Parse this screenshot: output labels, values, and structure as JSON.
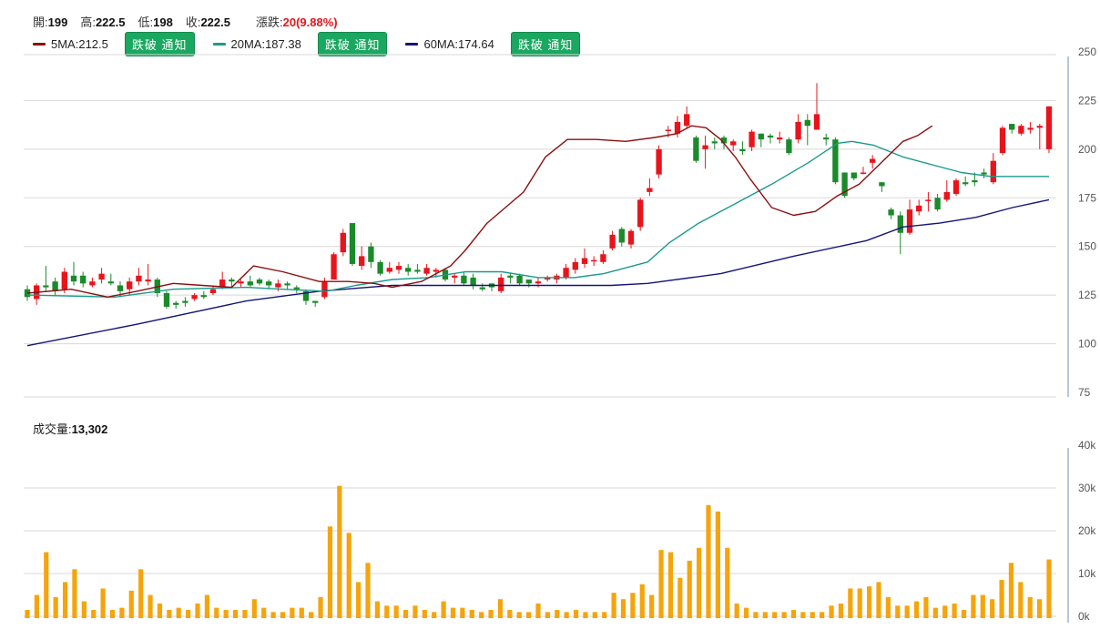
{
  "header": {
    "open_label": "開:",
    "open": "199",
    "high_label": "高:",
    "high": "222.5",
    "low_label": "低:",
    "low": "198",
    "close_label": "收:",
    "close": "222.5",
    "change_label": "漲跌:",
    "change": "20(9.88%)"
  },
  "ma_legend": [
    {
      "label": "5MA:212.5",
      "color": "#8b0e0e",
      "button": "跌破 通知"
    },
    {
      "label": "20MA:187.38",
      "color": "#1a9a8c",
      "button": "跌破 通知"
    },
    {
      "label": "60MA:174.64",
      "color": "#14147a",
      "button": "跌破 通知"
    }
  ],
  "volume_header": {
    "label": "成交量:",
    "value": "13,302"
  },
  "colors": {
    "up": "#e8141c",
    "down": "#1a8a2a",
    "volume": "#f5a40c",
    "ma5": "#8b0e0e",
    "ma20": "#1a9a8c",
    "ma60": "#14147a",
    "grid": "#d8d8d8"
  },
  "chart_data": [
    {
      "type": "candlestick",
      "ylim": [
        75,
        250
      ],
      "yticks": [
        250,
        225,
        200,
        175,
        150,
        125,
        100,
        75
      ],
      "candles": [
        [
          128,
          124,
          130,
          122
        ],
        [
          123,
          130,
          131,
          120
        ],
        [
          130,
          129,
          140,
          127
        ],
        [
          132,
          127,
          134,
          125
        ],
        [
          128,
          137,
          139,
          126
        ],
        [
          135,
          132,
          142,
          130
        ],
        [
          135,
          131,
          137,
          129
        ],
        [
          130,
          132,
          134,
          129
        ],
        [
          133,
          136,
          139,
          131
        ],
        [
          132,
          131,
          136,
          130
        ],
        [
          130,
          127,
          132,
          124
        ],
        [
          128,
          132,
          134,
          125
        ],
        [
          132,
          135,
          139,
          130
        ],
        [
          132,
          133,
          141,
          130
        ],
        [
          133,
          126,
          134,
          124
        ],
        [
          126,
          119,
          127,
          118
        ],
        [
          121,
          120,
          122,
          118
        ],
        [
          122,
          121,
          124,
          119
        ],
        [
          123,
          125,
          126,
          122
        ],
        [
          125,
          124,
          127,
          123
        ],
        [
          126,
          128,
          130,
          125
        ],
        [
          129,
          133,
          137,
          128
        ],
        [
          133,
          132,
          134,
          129
        ],
        [
          131,
          132,
          133,
          129
        ],
        [
          132,
          130,
          135,
          129
        ],
        [
          133,
          131,
          134,
          130
        ],
        [
          132,
          130,
          133,
          128
        ],
        [
          129,
          131,
          133,
          127
        ],
        [
          131,
          130,
          132,
          128
        ],
        [
          129,
          128,
          130,
          126
        ],
        [
          127,
          122,
          128,
          120
        ],
        [
          122,
          121,
          122,
          119
        ],
        [
          124,
          132,
          134,
          123
        ],
        [
          133,
          146,
          147,
          133
        ],
        [
          147,
          157,
          159,
          145
        ],
        [
          162,
          141,
          162,
          140
        ],
        [
          140,
          145,
          150,
          138
        ],
        [
          150,
          142,
          152,
          139
        ],
        [
          142,
          136,
          143,
          135
        ],
        [
          137,
          139,
          142,
          136
        ],
        [
          138,
          140,
          142,
          136
        ],
        [
          139,
          137,
          141,
          135
        ],
        [
          138,
          137,
          141,
          136
        ],
        [
          136,
          139,
          141,
          135
        ],
        [
          137,
          138,
          139,
          134
        ],
        [
          138,
          133,
          139,
          132
        ],
        [
          134,
          135,
          136,
          131
        ],
        [
          135,
          131,
          137,
          130
        ],
        [
          134,
          130,
          136,
          128
        ],
        [
          129,
          128,
          131,
          127
        ],
        [
          131,
          129,
          131,
          127
        ],
        [
          127,
          134,
          136,
          126
        ],
        [
          135,
          134,
          136,
          131
        ],
        [
          135,
          131,
          136,
          130
        ],
        [
          133,
          131,
          133,
          129
        ],
        [
          131,
          132,
          134,
          129
        ],
        [
          133,
          134,
          135,
          132
        ],
        [
          133,
          135,
          136,
          131
        ],
        [
          134,
          139,
          141,
          133
        ],
        [
          138,
          142,
          144,
          136
        ],
        [
          141,
          144,
          149,
          139
        ],
        [
          143,
          143,
          145,
          140
        ],
        [
          142,
          146,
          148,
          141
        ],
        [
          149,
          156,
          158,
          148
        ],
        [
          159,
          152,
          160,
          150
        ],
        [
          151,
          158,
          159,
          149
        ],
        [
          160,
          174,
          175,
          158
        ],
        [
          178,
          180,
          185,
          176
        ],
        [
          187,
          200,
          202,
          185
        ],
        [
          210,
          210,
          212,
          206
        ],
        [
          208,
          214,
          217,
          206
        ],
        [
          212,
          218,
          222,
          211
        ],
        [
          206,
          194,
          207,
          193
        ],
        [
          200,
          202,
          207,
          190
        ],
        [
          204,
          203,
          206,
          200
        ],
        [
          206,
          203,
          207,
          200
        ],
        [
          202,
          204,
          205,
          199
        ],
        [
          200,
          199,
          204,
          197
        ],
        [
          201,
          209,
          210,
          199
        ],
        [
          208,
          205,
          208,
          201
        ],
        [
          207,
          206,
          208,
          203
        ],
        [
          205,
          206,
          209,
          203
        ],
        [
          205,
          198,
          206,
          197
        ],
        [
          205,
          214,
          218,
          203
        ],
        [
          215,
          212,
          218,
          202
        ],
        [
          210,
          218,
          234,
          210
        ],
        [
          206,
          205,
          208,
          202
        ],
        [
          205,
          183,
          206,
          182
        ],
        [
          188,
          176,
          188,
          175
        ],
        [
          188,
          185,
          187,
          184
        ],
        [
          188,
          188,
          191,
          187
        ],
        [
          193,
          195,
          197,
          190
        ],
        [
          183,
          181,
          183,
          178
        ],
        [
          169,
          166,
          170,
          164
        ],
        [
          166,
          157,
          168,
          146
        ],
        [
          157,
          169,
          174,
          156
        ],
        [
          168,
          171,
          174,
          166
        ],
        [
          174,
          174,
          178,
          168
        ],
        [
          175,
          169,
          177,
          168
        ],
        [
          174,
          178,
          184,
          173
        ],
        [
          177,
          184,
          185,
          176
        ],
        [
          183,
          182,
          186,
          181
        ],
        [
          184,
          183,
          188,
          181
        ],
        [
          188,
          187,
          190,
          185
        ],
        [
          183,
          194,
          198,
          182
        ],
        [
          198,
          211,
          212,
          197
        ],
        [
          213,
          210,
          213,
          208
        ],
        [
          208,
          212,
          213,
          207
        ],
        [
          210,
          211,
          214,
          208
        ],
        [
          211,
          212,
          213,
          200
        ],
        [
          200,
          222,
          222,
          198
        ]
      ],
      "ma5": [
        [
          0,
          126
        ],
        [
          12,
          128
        ],
        [
          22,
          124
        ],
        [
          30,
          127
        ],
        [
          40,
          131
        ],
        [
          48,
          130
        ],
        [
          56,
          129
        ],
        [
          62,
          140
        ],
        [
          70,
          137
        ],
        [
          80,
          132
        ],
        [
          88,
          132
        ],
        [
          95,
          131
        ],
        [
          100,
          129
        ],
        [
          108,
          132
        ],
        [
          116,
          140
        ],
        [
          120,
          148
        ],
        [
          126,
          162
        ],
        [
          136,
          178
        ],
        [
          142,
          196
        ],
        [
          148,
          205
        ],
        [
          156,
          205
        ],
        [
          164,
          204
        ],
        [
          172,
          206
        ],
        [
          178,
          208
        ],
        [
          182,
          212
        ],
        [
          186,
          211
        ],
        [
          190,
          205
        ],
        [
          194,
          196
        ],
        [
          198,
          185
        ],
        [
          204,
          170
        ],
        [
          210,
          166
        ],
        [
          216,
          168
        ],
        [
          222,
          176
        ],
        [
          228,
          182
        ],
        [
          234,
          193
        ],
        [
          240,
          204
        ],
        [
          244,
          207
        ],
        [
          248,
          212
        ]
      ],
      "ma20": [
        [
          0,
          125
        ],
        [
          24,
          124
        ],
        [
          40,
          128
        ],
        [
          60,
          129
        ],
        [
          70,
          128
        ],
        [
          82,
          127
        ],
        [
          90,
          130
        ],
        [
          100,
          133
        ],
        [
          110,
          134
        ],
        [
          120,
          137
        ],
        [
          130,
          137
        ],
        [
          140,
          134
        ],
        [
          150,
          134
        ],
        [
          158,
          136
        ],
        [
          164,
          139
        ],
        [
          170,
          142
        ],
        [
          176,
          152
        ],
        [
          184,
          162
        ],
        [
          194,
          172
        ],
        [
          204,
          182
        ],
        [
          214,
          193
        ],
        [
          222,
          203
        ],
        [
          226,
          204
        ],
        [
          232,
          202
        ],
        [
          240,
          196
        ],
        [
          248,
          192
        ],
        [
          256,
          188
        ],
        [
          264,
          186
        ],
        [
          272,
          186
        ],
        [
          280,
          186
        ]
      ],
      "ma60": [
        [
          0,
          99
        ],
        [
          30,
          110
        ],
        [
          60,
          122
        ],
        [
          80,
          127
        ],
        [
          100,
          130
        ],
        [
          120,
          130
        ],
        [
          140,
          130
        ],
        [
          160,
          130
        ],
        [
          170,
          131
        ],
        [
          190,
          136
        ],
        [
          210,
          145
        ],
        [
          230,
          153
        ],
        [
          240,
          160
        ],
        [
          250,
          162
        ],
        [
          260,
          165
        ],
        [
          270,
          170
        ],
        [
          280,
          174
        ]
      ],
      "x_first": 30,
      "x_last": 1152,
      "ma_x_units": 280
    },
    {
      "type": "bar",
      "ylim": [
        0,
        40000
      ],
      "yticks": [
        "40k",
        "30k",
        "20k",
        "10k",
        "0k"
      ],
      "values": [
        1500,
        5000,
        15000,
        4500,
        8000,
        11000,
        3500,
        1500,
        6500,
        1500,
        2000,
        6000,
        11000,
        5000,
        3000,
        1500,
        2000,
        1500,
        3000,
        5000,
        2000,
        1500,
        1500,
        1500,
        4000,
        2000,
        1000,
        1000,
        2000,
        2000,
        1000,
        4500,
        21000,
        30500,
        19500,
        8000,
        12500,
        3500,
        2500,
        2500,
        1500,
        2500,
        1500,
        1000,
        3500,
        2000,
        2000,
        1500,
        1000,
        1500,
        4000,
        1500,
        1000,
        1000,
        3000,
        1000,
        1500,
        1000,
        1500,
        1000,
        1000,
        1000,
        5500,
        4000,
        5500,
        7500,
        5000,
        15500,
        15000,
        9000,
        13000,
        16000,
        26000,
        24500,
        16000,
        3000,
        2000,
        1000,
        1000,
        1000,
        1000,
        1500,
        1000,
        1000,
        1000,
        2500,
        3000,
        6500,
        6500,
        7000,
        8000,
        4500,
        2500,
        2500,
        3500,
        4500,
        2000,
        2500,
        3000,
        1500,
        5000,
        5000,
        4000,
        8500,
        12500,
        8000,
        4500,
        4000,
        13302
      ]
    }
  ]
}
